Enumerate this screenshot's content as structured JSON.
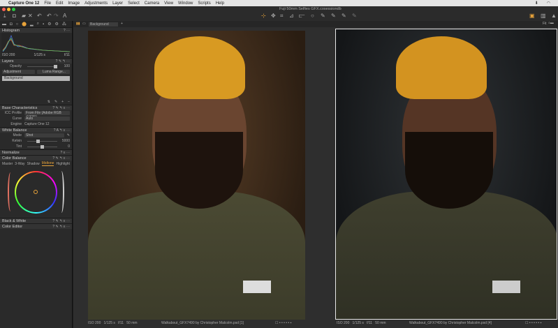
{
  "menubar": {
    "app": "Capture One 12",
    "items": [
      "File",
      "Edit",
      "Image",
      "Adjustments",
      "Layer",
      "Select",
      "Camera",
      "View",
      "Window",
      "Scripts",
      "Help"
    ]
  },
  "window": {
    "title": "Fuji 50mm Selfies GFX.cosessiondb"
  },
  "viewer": {
    "variant_select": "Background",
    "zoom": "Fit"
  },
  "histogram": {
    "title": "Histogram",
    "iso": "ISO 200",
    "shutter": "1/125 s",
    "aperture": "f/11"
  },
  "layers": {
    "title": "Layers",
    "opacity_label": "Opacity",
    "opacity_value": "100",
    "adjustment_btn": "Adjustment",
    "luma_btn": "Luma Range...",
    "items": [
      "Background"
    ]
  },
  "base": {
    "title": "Base Characteristics",
    "icc_label": "ICC Profile",
    "icc_value": "From File (Adobe RGB (1998))",
    "curve_label": "Curve",
    "curve_value": "Auto",
    "engine_label": "Engine",
    "engine_value": "Capture One 12"
  },
  "wb": {
    "title": "White Balance",
    "mode_label": "Mode",
    "mode_value": "Shot",
    "kelvin_label": "Kelvin",
    "kelvin_value": "5000",
    "tint_label": "Tint",
    "tint_value": "0"
  },
  "normalize": {
    "title": "Normalize"
  },
  "color_balance": {
    "title": "Color Balance",
    "tabs": [
      "Master",
      "3-Way",
      "Shadow",
      "Midtone",
      "Highlight"
    ],
    "active_tab": "Midtone"
  },
  "bw": {
    "title": "Black & White"
  },
  "color_editor": {
    "title": "Color Editor"
  },
  "images": [
    {
      "iso": "ISO 200",
      "shutter": "1/125 s",
      "aperture": "f/11",
      "focal": "50 mm",
      "filename": "Walkabout_GFX7490 by Christopher Malcolm.psd [1]"
    },
    {
      "iso": "ISO 200",
      "shutter": "1/125 s",
      "aperture": "f/11",
      "focal": "50 mm",
      "filename": "Walkabout_GFX7490 by Christopher Malcolm.psd [4]"
    }
  ],
  "colors": {
    "accent": "#e8a33a",
    "traffic": [
      "#fe5f57",
      "#febc2e",
      "#28c840"
    ]
  }
}
